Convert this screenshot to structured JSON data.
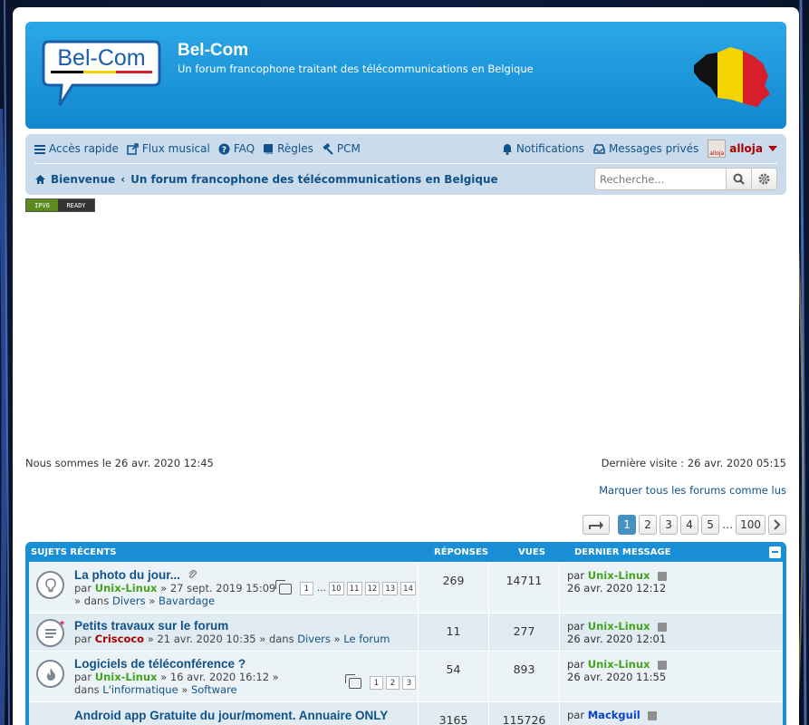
{
  "header": {
    "logo_text": "Bel-Com",
    "site_title": "Bel-Com",
    "site_description": "Un forum francophone traitant des télécommunications en Belgique"
  },
  "nav": {
    "left": [
      {
        "label": "Accès rapide",
        "icon": "menu-icon"
      },
      {
        "label": "Flux musical",
        "icon": "external-link-icon"
      },
      {
        "label": "FAQ",
        "icon": "question-circle-icon"
      },
      {
        "label": "Règles",
        "icon": "book-icon"
      },
      {
        "label": "PCM",
        "icon": "gavel-icon"
      }
    ],
    "right": [
      {
        "label": "Notifications",
        "icon": "bell-icon"
      },
      {
        "label": "Messages privés",
        "icon": "inbox-icon"
      }
    ],
    "user": {
      "name": "alloja",
      "avatar_label": "alloja"
    }
  },
  "breadcrumb": {
    "home": "Bienvenue",
    "current": "Un forum francophone des télécommunications en Belgique"
  },
  "search": {
    "placeholder": "Recherche..."
  },
  "badge": {
    "left": "IPV6",
    "right": "READY"
  },
  "times": {
    "current": "Nous sommes le 26 avr. 2020 12:45",
    "last_visit": "Dernière visite : 26 avr. 2020 05:15"
  },
  "mark_all": "Marquer tous les forums comme lus",
  "pagination": {
    "pages": [
      "1",
      "2",
      "3",
      "4",
      "5"
    ],
    "ellipsis": "…",
    "last": "100",
    "active": "1"
  },
  "table": {
    "headers": {
      "topics": "SUJETS RÉCENTS",
      "replies": "RÉPONSES",
      "views": "VUES",
      "last": "DERNIER MESSAGE"
    },
    "rows": [
      {
        "title": "La photo du jour...",
        "by": "par",
        "author": "Unix-Linux",
        "date": "» 27 sept. 2019 15:09",
        "location_prefix": "» dans",
        "forum1": "Divers",
        "forum_sep": "»",
        "forum2": "Bavardage",
        "pages": [
          "1",
          "10",
          "11",
          "12",
          "13",
          "14"
        ],
        "pages_ellipsis": "…",
        "replies": "269",
        "views": "14711",
        "last_by": "par",
        "last_author": "Unix-Linux",
        "last_date": "26 avr. 2020 12:12"
      },
      {
        "title": "Petits travaux sur le forum",
        "by": "par",
        "author": "Criscoco",
        "date": "» 21 avr. 2020 10:35 » dans",
        "forum1": "Divers",
        "forum_sep": "»",
        "forum2": "Le forum",
        "replies": "11",
        "views": "277",
        "last_by": "par",
        "last_author": "Unix-Linux",
        "last_date": "26 avr. 2020 12:01"
      },
      {
        "title": "Logiciels de téléconférence ?",
        "by": "par",
        "author": "Unix-Linux",
        "date": "» 16 avr. 2020 16:12 » dans",
        "forum1": "L'informatique",
        "forum_sep": "»",
        "forum2": "Software",
        "pages": [
          "1",
          "2",
          "3"
        ],
        "replies": "54",
        "views": "893",
        "last_by": "par",
        "last_author": "Unix-Linux",
        "last_date": "26 avr. 2020 11:55"
      },
      {
        "title": "Android app Gratuite du jour/moment. Annuaire ONLY",
        "replies": "3165",
        "views": "115726",
        "last_by": "par",
        "last_author": "Mackguil"
      }
    ]
  },
  "colors": {
    "header_blue": "#1a8ed6",
    "nav_bg": "#cadceb",
    "link": "#105289",
    "user_red": "#aa0000",
    "user_green": "#42a51f"
  }
}
